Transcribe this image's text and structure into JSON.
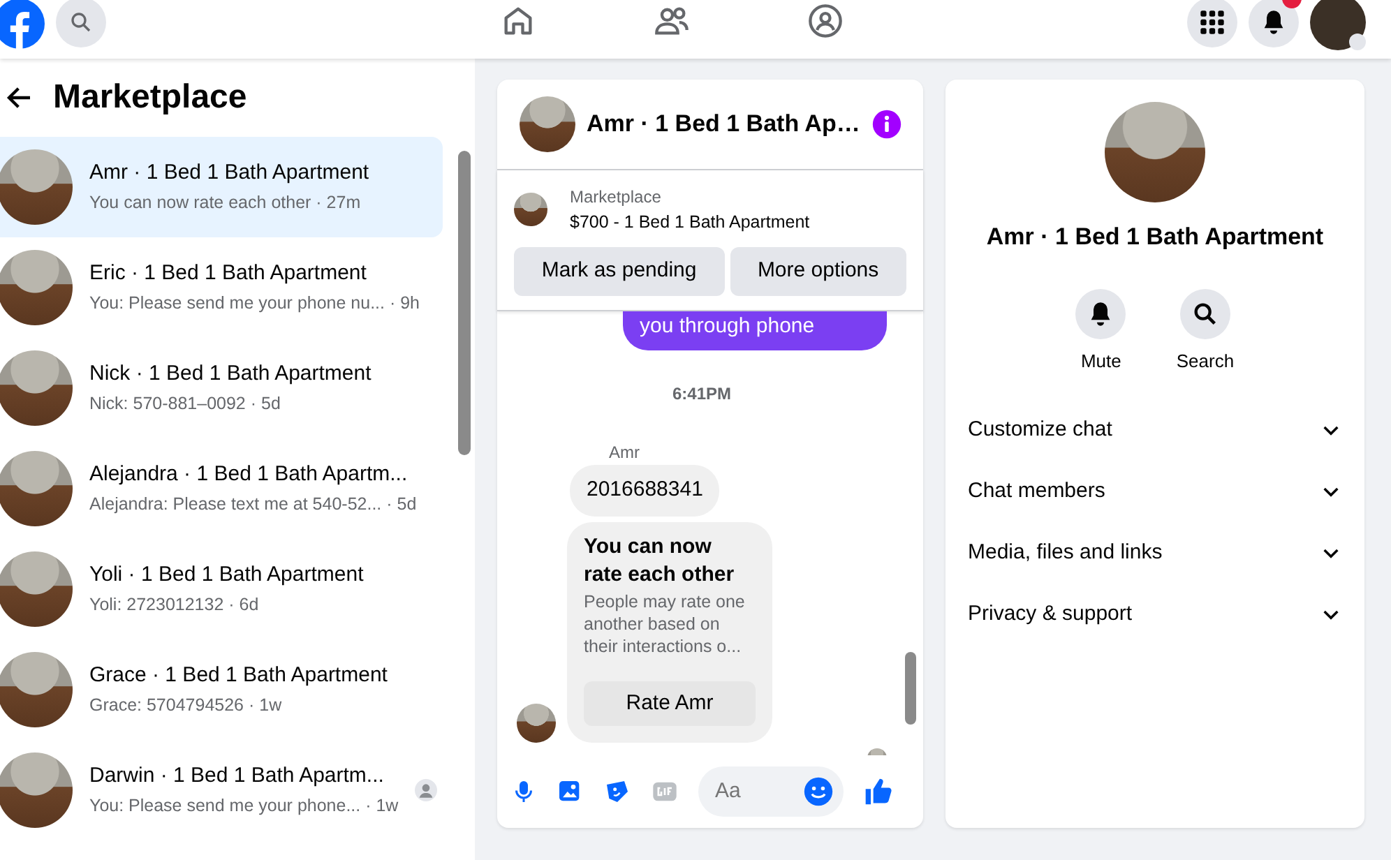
{
  "topbar": {
    "nav": [
      {
        "kind": "home"
      },
      {
        "kind": "friends"
      },
      {
        "kind": "groups"
      }
    ],
    "notifications_badge": true
  },
  "sidebar": {
    "title": "Marketplace",
    "conversations": [
      {
        "title": "Amr · 1 Bed 1 Bath Apartment",
        "preview": "You can now rate each other · 27m",
        "selected": true,
        "read_receipt": false
      },
      {
        "title": "Eric · 1 Bed 1 Bath Apartment",
        "preview": "You: Please send me your phone nu... · 9h",
        "selected": false,
        "read_receipt": false
      },
      {
        "title": "Nick · 1 Bed 1 Bath Apartment",
        "preview": "Nick: 570-881–0092 · 5d",
        "selected": false,
        "read_receipt": false
      },
      {
        "title": "Alejandra · 1 Bed 1 Bath Apartm...",
        "preview": "Alejandra: Please text me at 540-52... · 5d",
        "selected": false,
        "read_receipt": false
      },
      {
        "title": "Yoli · 1 Bed 1 Bath Apartment",
        "preview": "Yoli: 2723012132 · 6d",
        "selected": false,
        "read_receipt": false
      },
      {
        "title": "Grace · 1 Bed 1 Bath Apartment",
        "preview": "Grace: 5704794526 · 1w",
        "selected": false,
        "read_receipt": false
      },
      {
        "title": "Darwin · 1 Bed 1 Bath Apartm...",
        "preview": "You: Please send me your phone... · 1w",
        "selected": false,
        "read_receipt": true
      }
    ]
  },
  "chat": {
    "title": "Amr · 1 Bed 1 Bath Ap…",
    "listing": {
      "label": "Marketplace",
      "title": "$700 - 1 Bed 1 Bath Apartment",
      "buttons": [
        "Mark as pending",
        "More options"
      ]
    },
    "messages": [
      {
        "kind": "outgoing",
        "text": "you through phone"
      },
      {
        "kind": "timestamp",
        "text": "6:41PM"
      },
      {
        "kind": "sender",
        "text": "Amr"
      },
      {
        "kind": "incoming",
        "text": "2016688341"
      },
      {
        "kind": "rating",
        "title": "You can now rate each other",
        "text": "People may rate one another based on their interactions o...",
        "button": "Rate Amr"
      }
    ],
    "composer": {
      "placeholder": "Aa"
    }
  },
  "details": {
    "title": "Amr · 1 Bed 1 Bath Apartment",
    "actions": [
      {
        "kind": "mute",
        "label": "Mute"
      },
      {
        "kind": "search",
        "label": "Search"
      }
    ],
    "sections": [
      {
        "label": "Customize chat",
        "expanded": false
      },
      {
        "label": "Chat members",
        "expanded": false
      },
      {
        "label": "Media, files and links",
        "expanded": false
      },
      {
        "label": "Privacy & support",
        "expanded": false
      }
    ]
  }
}
